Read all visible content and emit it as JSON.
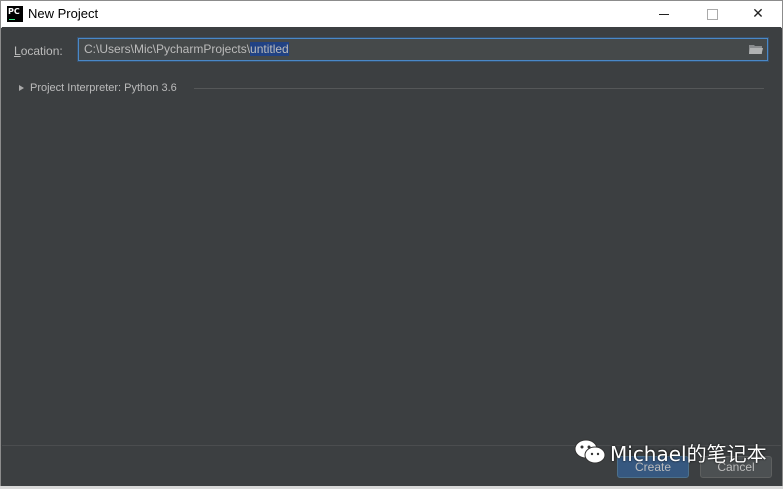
{
  "window": {
    "title": "New Project",
    "app_icon_text": "PC"
  },
  "location": {
    "label_prefix": "L",
    "label_rest": "ocation:",
    "path_prefix": "C:\\Users\\Mic\\PycharmProjects\\",
    "path_selected": "untitled"
  },
  "interpreter": {
    "label": "Project Interpreter: Python 3.6"
  },
  "buttons": {
    "create": "Create",
    "cancel": "Cancel"
  },
  "watermark": {
    "text": "Michael的笔记本"
  },
  "colors": {
    "panel": "#3c3f41",
    "accent": "#4a88c7",
    "selection": "#214283"
  }
}
